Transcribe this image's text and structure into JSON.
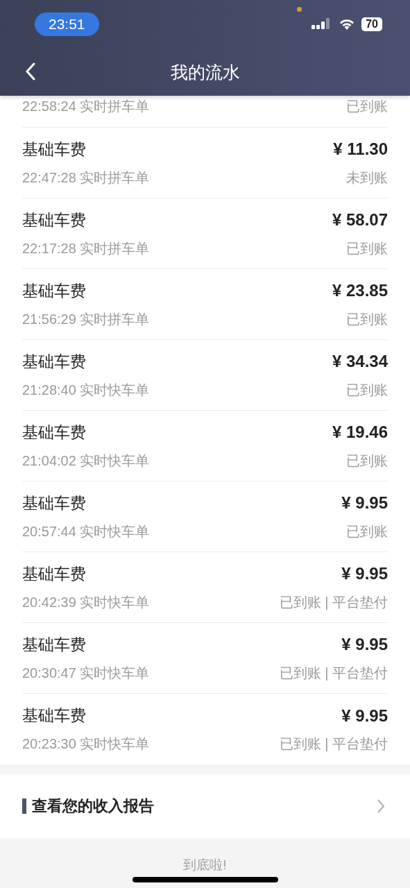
{
  "status_bar": {
    "time": "23:51",
    "battery": "70"
  },
  "nav": {
    "title": "我的流水"
  },
  "records": [
    {
      "time_type": "22:58:24 实时拼车单",
      "status": "已到账"
    },
    {
      "title": "基础车费",
      "amount": "¥ 11.30",
      "time_type": "22:47:28 实时拼车单",
      "status": "未到账"
    },
    {
      "title": "基础车费",
      "amount": "¥ 58.07",
      "time_type": "22:17:28 实时拼车单",
      "status": "已到账"
    },
    {
      "title": "基础车费",
      "amount": "¥ 23.85",
      "time_type": "21:56:29 实时拼车单",
      "status": "已到账"
    },
    {
      "title": "基础车费",
      "amount": "¥ 34.34",
      "time_type": "21:28:40 实时快车单",
      "status": "已到账"
    },
    {
      "title": "基础车费",
      "amount": "¥ 19.46",
      "time_type": "21:04:02 实时快车单",
      "status": "已到账"
    },
    {
      "title": "基础车费",
      "amount": "¥ 9.95",
      "time_type": "20:57:44 实时快车单",
      "status": "已到账"
    },
    {
      "title": "基础车费",
      "amount": "¥ 9.95",
      "time_type": "20:42:39 实时快车单",
      "status": "已到账 | 平台垫付"
    },
    {
      "title": "基础车费",
      "amount": "¥ 9.95",
      "time_type": "20:30:47 实时快车单",
      "status": "已到账 | 平台垫付"
    },
    {
      "title": "基础车费",
      "amount": "¥ 9.95",
      "time_type": "20:23:30 实时快车单",
      "status": "已到账 | 平台垫付"
    }
  ],
  "report_link": {
    "label": "查看您的收入报告"
  },
  "footer": {
    "text": "到底啦!"
  }
}
